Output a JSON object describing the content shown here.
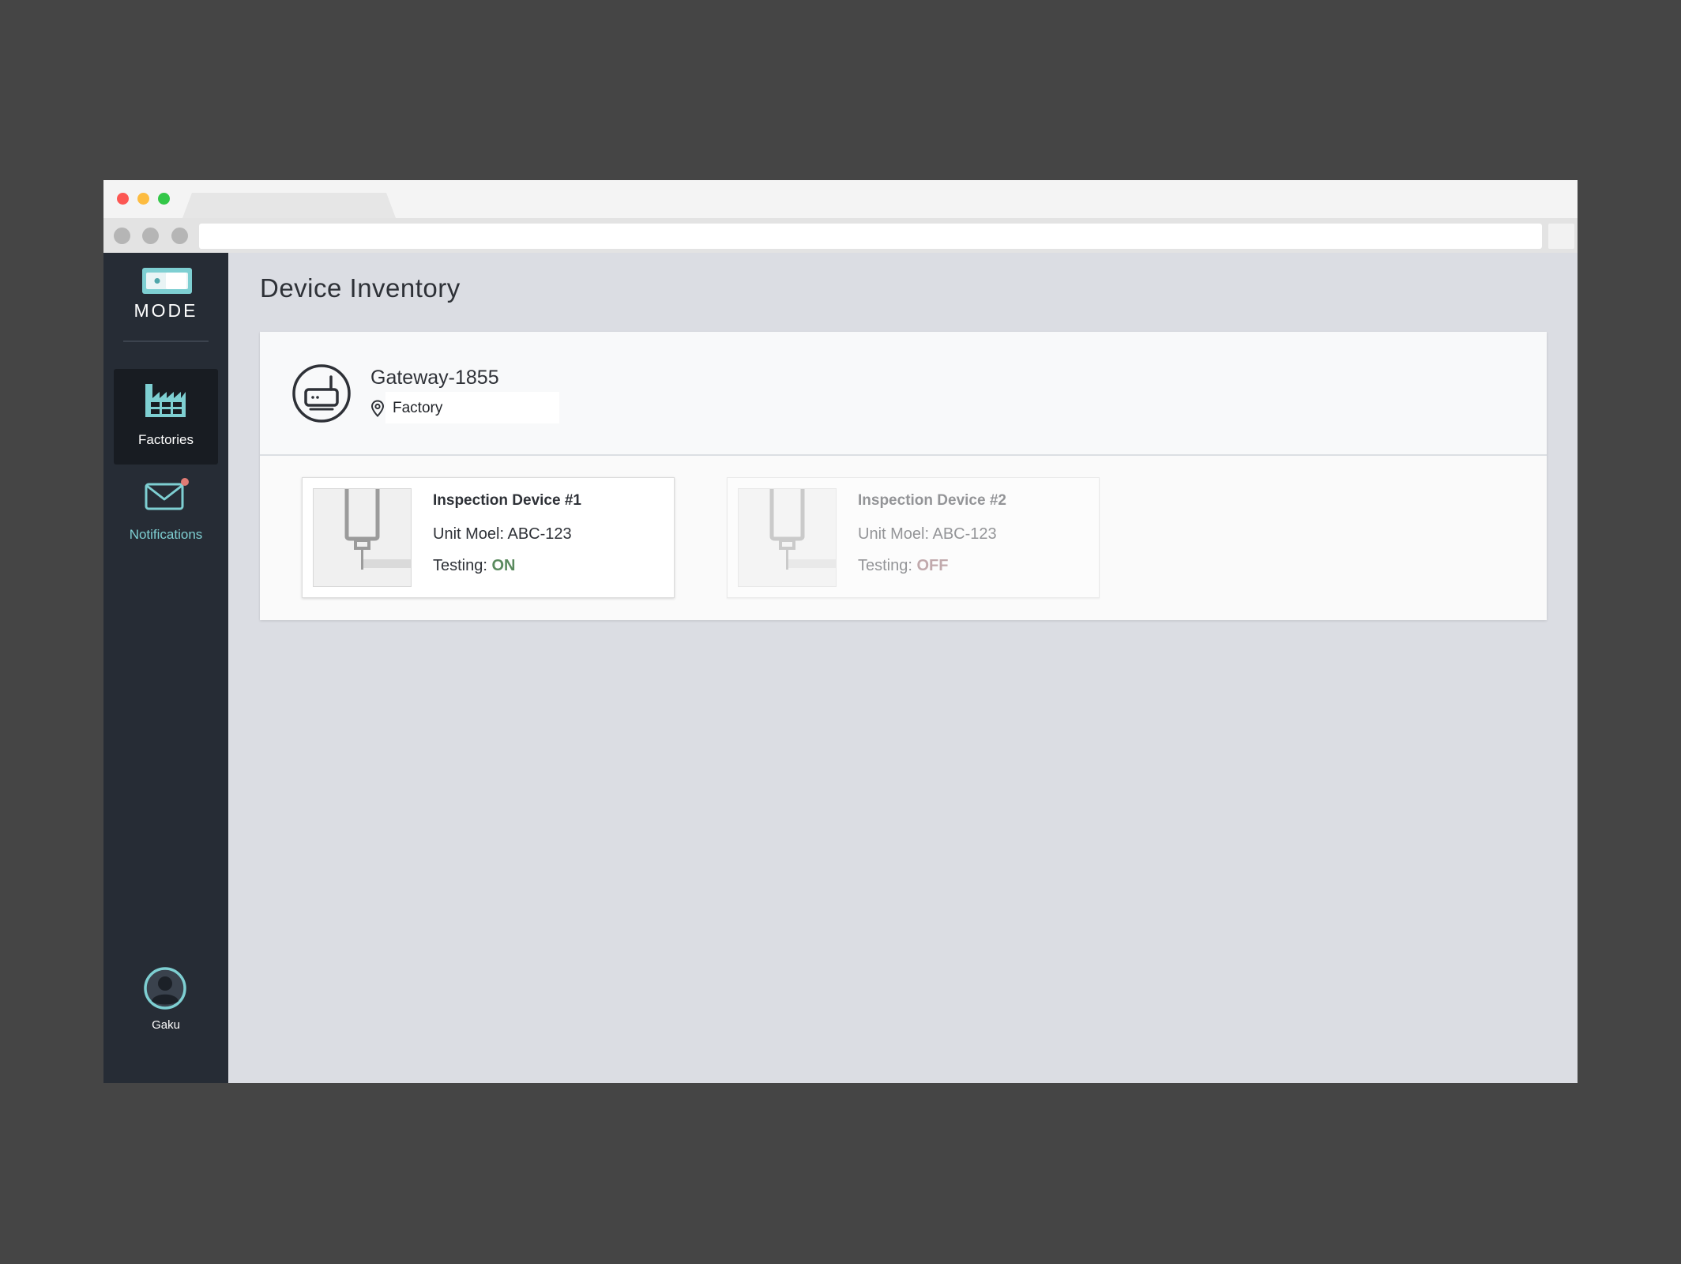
{
  "app": {
    "brand": "MODE",
    "page_title": "Device Inventory"
  },
  "browser": {
    "url": ""
  },
  "sidebar": {
    "items": [
      {
        "label": "Factories",
        "icon": "factory-icon",
        "active": true
      },
      {
        "label": "Notifications",
        "icon": "mail-icon",
        "badge": true
      }
    ],
    "user": {
      "name": "Gaku",
      "icon": "user-avatar-icon"
    }
  },
  "gateway": {
    "name": "Gateway-1855",
    "location": "Factory",
    "icon": "router-icon"
  },
  "devices": [
    {
      "name": "Inspection Device #1",
      "model_label": "Unit Moel:",
      "model": "ABC-123",
      "testing_label": "Testing:",
      "testing": "ON"
    },
    {
      "name": "Inspection Device #2",
      "model_label": "Unit Moel:",
      "model": "ABC-123",
      "testing_label": "Testing:",
      "testing": "OFF"
    }
  ],
  "colors": {
    "accent": "#7ecfd2",
    "sidebar_bg": "#262c35",
    "status_on": "#5a8a5e",
    "status_off": "#8a5a60",
    "badge": "#e07b74"
  }
}
